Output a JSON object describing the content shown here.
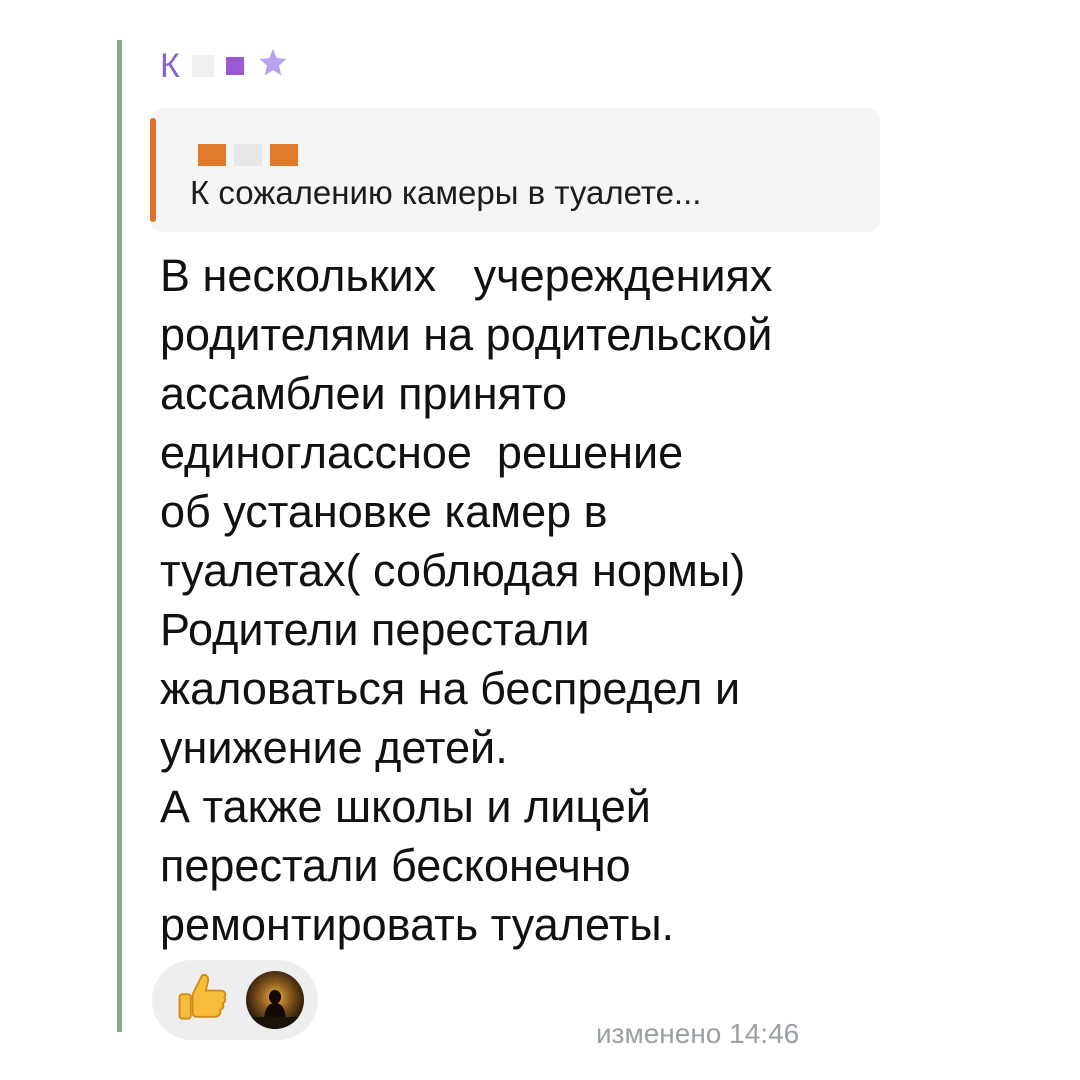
{
  "sender": {
    "initial": "К",
    "badge_colors": [
      "#f0f0f0",
      "#9b59d6"
    ],
    "star_icon": "star-icon",
    "star_color": "#b7a3f0"
  },
  "reply": {
    "author_colors": [
      "#e07b2e",
      "#e8e8e8",
      "#e07b2e"
    ],
    "bar_color": "#e0702a",
    "text": "К сожалению камеры в туалете..."
  },
  "message": {
    "lines": [
      "В нескольких   учереждениях",
      "родителями на родительской",
      "ассамблеи принято",
      "единоглассное  решение",
      "об установке камер в",
      "туалетах( соблюдая нормы)",
      "Родители перестали",
      "жаловаться на беспредел и",
      "унижение детей.",
      "А также школы и лицей",
      "перестали бесконечно",
      "ремонтировать туалеты."
    ]
  },
  "reactions": [
    {
      "icon": "thumbs-up-icon"
    },
    {
      "icon": "avatar-icon"
    }
  ],
  "footer": {
    "edited": "изменено 14:46"
  }
}
